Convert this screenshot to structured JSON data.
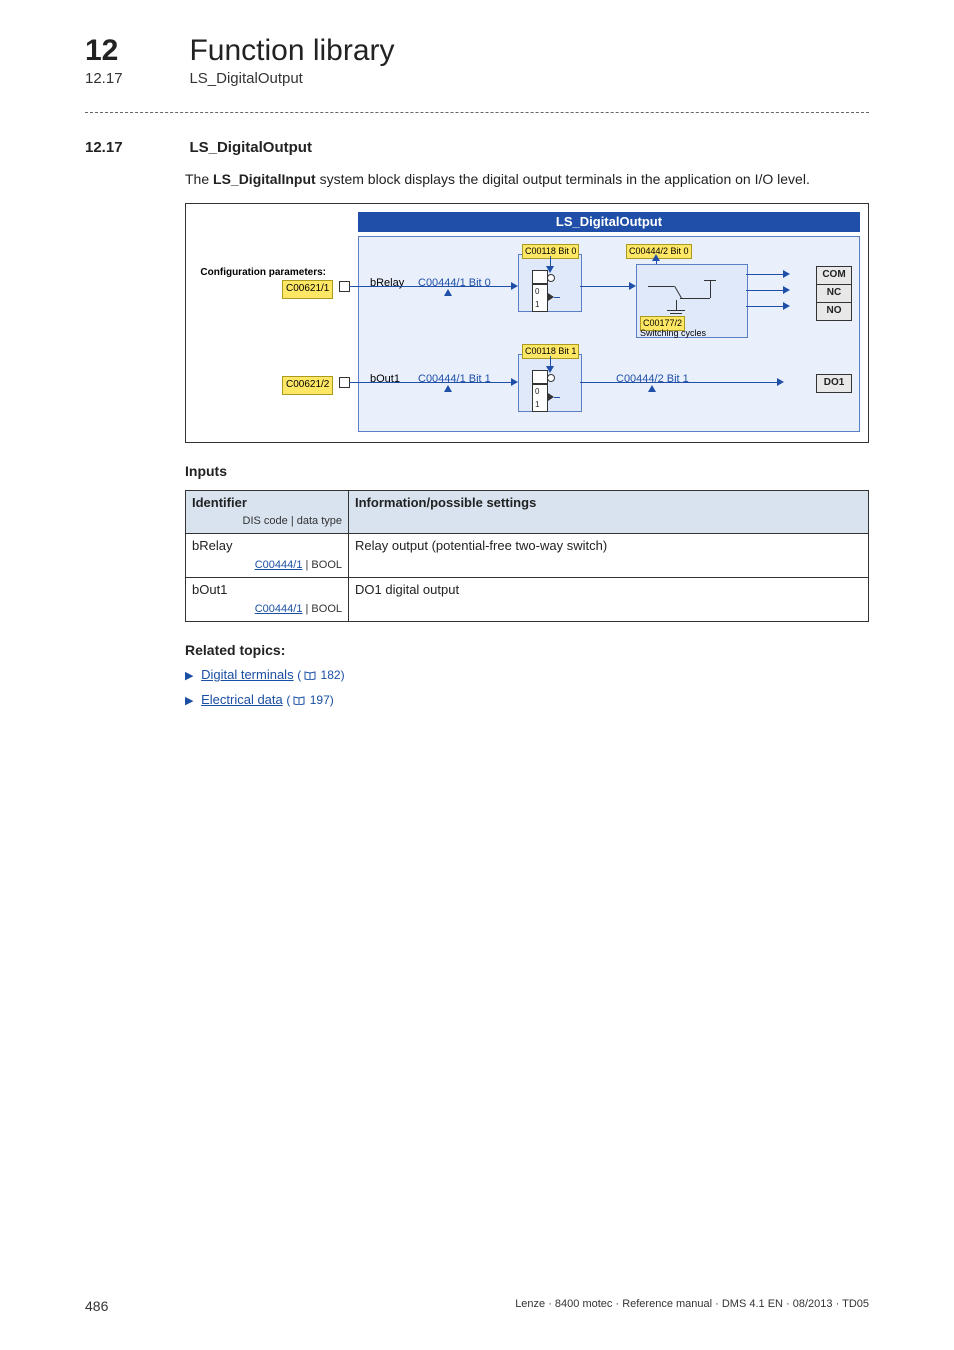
{
  "header": {
    "chapter_number": "12",
    "chapter_title": "Function library",
    "sub_number": "12.17",
    "sub_title": "LS_DigitalOutput"
  },
  "section": {
    "number": "12.17",
    "title": "LS_DigitalOutput",
    "intro_prefix": "The ",
    "intro_bold": "LS_DigitalInput",
    "intro_suffix": " system block displays the digital output terminals in the application on I/O level."
  },
  "diagram": {
    "title": "LS_DigitalOutput",
    "cfg_label": "Configuration parameters:",
    "cfg_codes": [
      "C00621/1",
      "C00621/2"
    ],
    "signals": {
      "relay_name": "bRelay",
      "relay_code": "C00444/1 Bit 0",
      "out1_name": "bOut1",
      "out1_code": "C00444/1 Bit 1"
    },
    "tags": {
      "bit0_a": "C00118 Bit 0",
      "bit0_b": "C00444/2 Bit 0",
      "bit1_a": "C00118 Bit 1",
      "bit1_b": "C00444/2 Bit 1",
      "sw_code": "C00177/2",
      "sw_label": "Switching cycles"
    },
    "terminals": [
      "COM",
      "NC",
      "NO",
      "DO1"
    ]
  },
  "inputs": {
    "heading": "Inputs",
    "th_identifier": "Identifier",
    "th_identifier_sub": "DIS code | data type",
    "th_info": "Information/possible settings",
    "rows": [
      {
        "id": "bRelay",
        "code": "C00444/1",
        "dtype": " | BOOL",
        "info": "Relay output (potential-free two-way switch)"
      },
      {
        "id": "bOut1",
        "code": "C00444/1",
        "dtype": " | BOOL",
        "info": "DO1 digital output"
      }
    ]
  },
  "related": {
    "heading": "Related topics:",
    "items": [
      {
        "label": "Digital terminals",
        "page": "182"
      },
      {
        "label": "Electrical data",
        "page": "197"
      }
    ]
  },
  "footer": {
    "page": "486",
    "right": "Lenze · 8400 motec · Reference manual · DMS 4.1 EN · 08/2013 · TD05"
  }
}
